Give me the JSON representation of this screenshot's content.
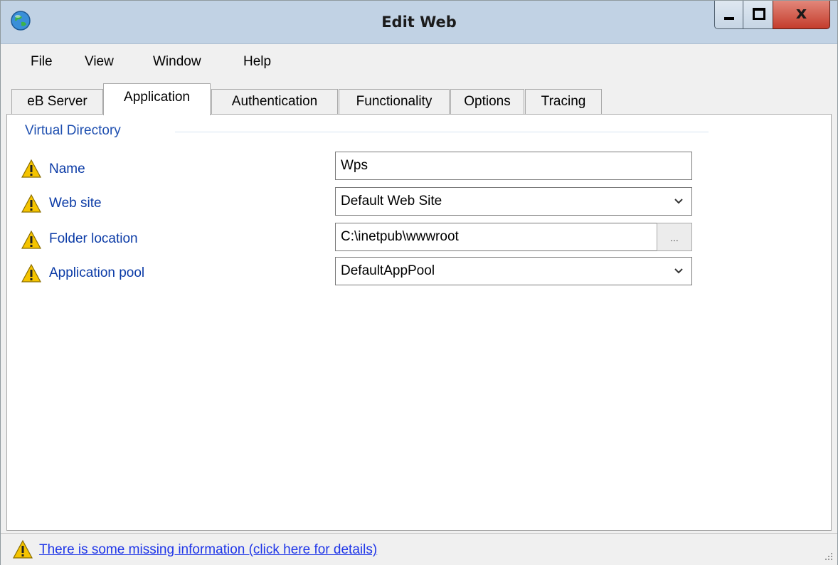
{
  "window": {
    "title": "Edit Web"
  },
  "menu": [
    "File",
    "View",
    "Window",
    "Help"
  ],
  "tabs": [
    {
      "label": "eB Server"
    },
    {
      "label": "Application",
      "active": true
    },
    {
      "label": "Authentication"
    },
    {
      "label": "Functionality"
    },
    {
      "label": "Options"
    },
    {
      "label": "Tracing"
    }
  ],
  "group": {
    "title": "Virtual Directory"
  },
  "fields": {
    "name": {
      "label": "Name",
      "value": "Wps"
    },
    "web_site": {
      "label": "Web site",
      "value": "Default Web Site"
    },
    "folder_location": {
      "label": "Folder location",
      "value": "C:\\inetpub\\wwwroot",
      "browse_label": "..."
    },
    "application_pool": {
      "label": "Application pool",
      "value": "DefaultAppPool"
    }
  },
  "status": {
    "message": "There is some missing information (click here for details)"
  },
  "colors": {
    "titlebar": "#c1d2e4",
    "label_blue": "#0a3aa6",
    "group_title_blue": "#1e4fb0",
    "link_blue": "#1f36e8",
    "warning_yellow": "#f5c400",
    "close_red": "#c43c2c"
  },
  "icons": {
    "app": "globe-icon",
    "warning": "warning-icon",
    "dropdown": "chevron-down-icon"
  }
}
